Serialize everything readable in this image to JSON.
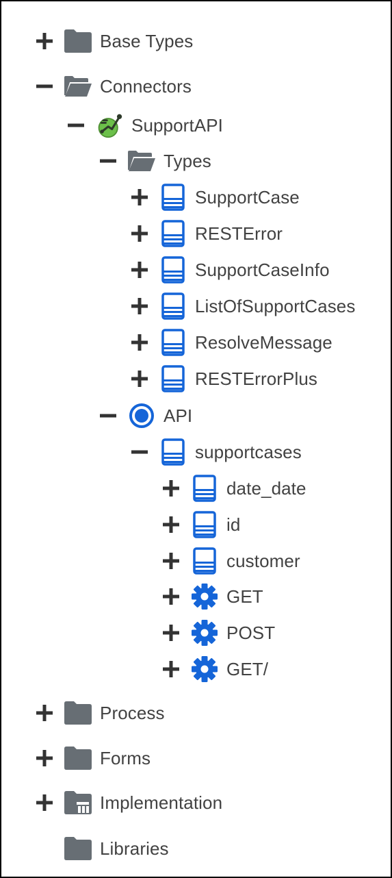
{
  "colors": {
    "folder": "#676e74",
    "blue": "#1565d8",
    "toggle": "#333333",
    "text": "#424242",
    "connector_green": "#6cc04a"
  },
  "tree": [
    {
      "label": "Base Types",
      "depth": 0,
      "toggle": "plus",
      "icon": "folder-icon"
    },
    {
      "label": "Connectors",
      "depth": 0,
      "toggle": "minus",
      "icon": "folder-open-icon"
    },
    {
      "label": "SupportAPI",
      "depth": 1,
      "toggle": "minus",
      "icon": "connector-icon"
    },
    {
      "label": "Types",
      "depth": 2,
      "toggle": "minus",
      "icon": "folder-open-icon"
    },
    {
      "label": "SupportCase",
      "depth": 3,
      "toggle": "plus",
      "icon": "type-icon"
    },
    {
      "label": "RESTError",
      "depth": 3,
      "toggle": "plus",
      "icon": "type-icon"
    },
    {
      "label": "SupportCaseInfo",
      "depth": 3,
      "toggle": "plus",
      "icon": "type-icon"
    },
    {
      "label": "ListOfSupportCases",
      "depth": 3,
      "toggle": "plus",
      "icon": "type-icon"
    },
    {
      "label": "ResolveMessage",
      "depth": 3,
      "toggle": "plus",
      "icon": "type-icon"
    },
    {
      "label": "RESTErrorPlus",
      "depth": 3,
      "toggle": "plus",
      "icon": "type-icon"
    },
    {
      "label": "API",
      "depth": 2,
      "toggle": "minus",
      "icon": "api-icon"
    },
    {
      "label": "supportcases",
      "depth": 3,
      "toggle": "minus",
      "icon": "type-icon"
    },
    {
      "label": "date_date",
      "depth": 4,
      "toggle": "plus",
      "icon": "type-icon"
    },
    {
      "label": "id",
      "depth": 4,
      "toggle": "plus",
      "icon": "type-icon"
    },
    {
      "label": "customer",
      "depth": 4,
      "toggle": "plus",
      "icon": "type-icon"
    },
    {
      "label": "GET",
      "depth": 4,
      "toggle": "plus",
      "icon": "gear-icon"
    },
    {
      "label": "POST",
      "depth": 4,
      "toggle": "plus",
      "icon": "gear-icon"
    },
    {
      "label": "GET/",
      "depth": 4,
      "toggle": "plus",
      "icon": "gear-icon"
    },
    {
      "label": "Process",
      "depth": 0,
      "toggle": "plus",
      "icon": "folder-icon"
    },
    {
      "label": "Forms",
      "depth": 0,
      "toggle": "plus",
      "icon": "folder-icon"
    },
    {
      "label": "Implementation",
      "depth": 0,
      "toggle": "plus",
      "icon": "implementation-folder-icon"
    },
    {
      "label": "Libraries",
      "depth": 0,
      "toggle": "none",
      "icon": "folder-icon"
    }
  ]
}
